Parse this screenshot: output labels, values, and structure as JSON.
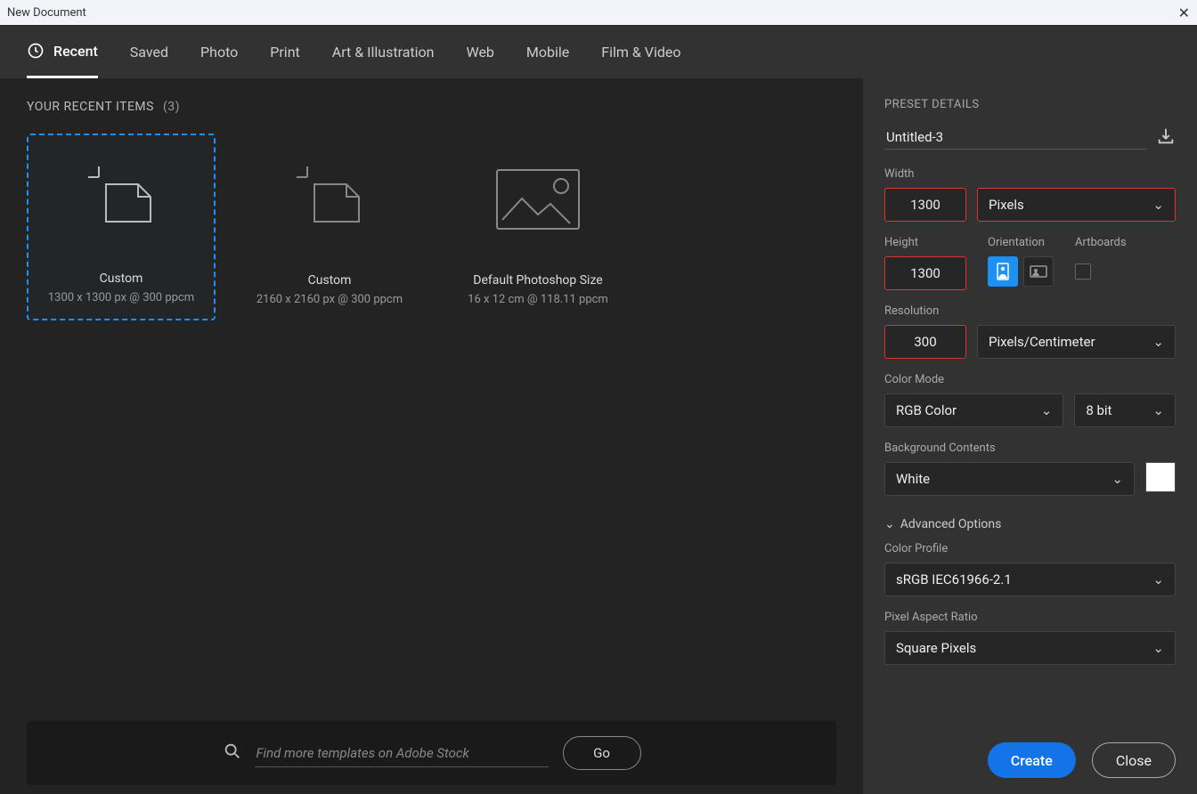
{
  "window": {
    "title": "New Document"
  },
  "tabs": [
    "Recent",
    "Saved",
    "Photo",
    "Print",
    "Art & Illustration",
    "Web",
    "Mobile",
    "Film & Video"
  ],
  "recent": {
    "header": "YOUR RECENT ITEMS",
    "count": "(3)",
    "items": [
      {
        "name": "Custom",
        "meta": "1300 x 1300 px @ 300 ppcm"
      },
      {
        "name": "Custom",
        "meta": "2160 x 2160 px @ 300 ppcm"
      },
      {
        "name": "Default Photoshop Size",
        "meta": "16 x 12 cm @ 118.11 ppcm"
      }
    ]
  },
  "stock": {
    "placeholder": "Find more templates on Adobe Stock",
    "go": "Go"
  },
  "panel": {
    "title": "PRESET DETAILS",
    "docname": "Untitled-3",
    "width_label": "Width",
    "width_value": "1300",
    "width_unit": "Pixels",
    "height_label": "Height",
    "height_value": "1300",
    "orientation_label": "Orientation",
    "artboards_label": "Artboards",
    "resolution_label": "Resolution",
    "resolution_value": "300",
    "resolution_unit": "Pixels/Centimeter",
    "colormode_label": "Color Mode",
    "colormode_value": "RGB Color",
    "bitdepth_value": "8 bit",
    "bg_label": "Background Contents",
    "bg_value": "White",
    "advanced": "Advanced Options",
    "profile_label": "Color Profile",
    "profile_value": "sRGB IEC61966-2.1",
    "par_label": "Pixel Aspect Ratio",
    "par_value": "Square Pixels",
    "create": "Create",
    "close": "Close"
  }
}
